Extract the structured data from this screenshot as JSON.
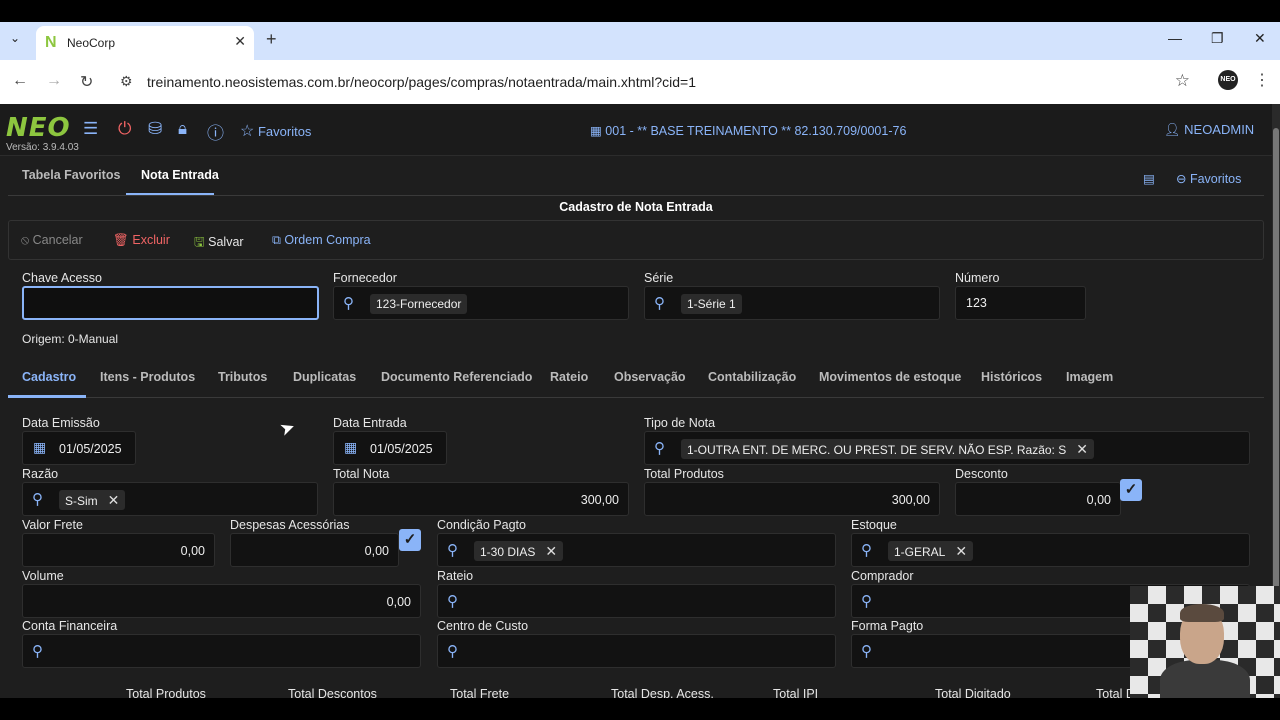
{
  "browser": {
    "tab_title": "NeoCorp",
    "tab_close": "✕",
    "new_tab": "+",
    "url": "treinamento.neosistemas.com.br/neocorp/pages/compras/notaentrada/main.xhtml?cid=1",
    "avatar_text": "NEO"
  },
  "app": {
    "logo": "NEO",
    "version": "Versão: 3.9.4.03",
    "favorites_label": "Favoritos",
    "company": "001 - ** BASE TREINAMENTO ** 82.130.709/0001-76",
    "user": "NEOADMIN"
  },
  "page_tabs": [
    "Tabela Favoritos",
    "Nota Entrada"
  ],
  "page_favorites": "Favoritos",
  "form": {
    "title": "Cadastro de Nota Entrada",
    "actions": {
      "cancel": "Cancelar",
      "delete": "Excluir",
      "save": "Salvar",
      "purchase_order": "Ordem Compra"
    },
    "chave_acesso": {
      "label": "Chave Acesso",
      "value": ""
    },
    "fornecedor": {
      "label": "Fornecedor",
      "value": "123-Fornecedor"
    },
    "serie": {
      "label": "Série",
      "value": "1-Série 1"
    },
    "numero": {
      "label": "Número",
      "value": "123"
    },
    "origem": "Origem: 0-Manual"
  },
  "sub_tabs": [
    "Cadastro",
    "Itens - Produtos",
    "Tributos",
    "Duplicatas",
    "Documento Referenciado",
    "Rateio",
    "Observação",
    "Contabilização",
    "Movimentos de estoque",
    "Históricos",
    "Imagem"
  ],
  "cadastro": {
    "data_emissao": {
      "label": "Data Emissão",
      "value": "01/05/2025"
    },
    "data_entrada": {
      "label": "Data Entrada",
      "value": "01/05/2025"
    },
    "tipo_nota": {
      "label": "Tipo de Nota",
      "value": "1-OUTRA ENT. DE MERC. OU PREST. DE SERV. NÃO ESP. Razão: S"
    },
    "razao": {
      "label": "Razão",
      "value": "S-Sim"
    },
    "total_nota": {
      "label": "Total Nota",
      "value": "300,00"
    },
    "total_produtos": {
      "label": "Total Produtos",
      "value": "300,00"
    },
    "desconto": {
      "label": "Desconto",
      "value": "0,00"
    },
    "valor_frete": {
      "label": "Valor Frete",
      "value": "0,00"
    },
    "despesas": {
      "label": "Despesas Acessórias",
      "value": "0,00"
    },
    "condicao": {
      "label": "Condição Pagto",
      "value": "1-30 DIAS"
    },
    "estoque": {
      "label": "Estoque",
      "value": "1-GERAL"
    },
    "volume": {
      "label": "Volume",
      "value": "0,00"
    },
    "rateio": {
      "label": "Rateio"
    },
    "comprador": {
      "label": "Comprador"
    },
    "conta_financeira": {
      "label": "Conta Financeira"
    },
    "centro_custo": {
      "label": "Centro de Custo"
    },
    "forma_pagto": {
      "label": "Forma Pagto"
    }
  },
  "totals": [
    "Total Produtos",
    "Total Descontos",
    "Total Frete",
    "Total Desp. Acess.",
    "Total IPI",
    "Total Digitado",
    "Total D"
  ],
  "colors": {
    "accent": "#8ab4f8",
    "brand": "#8dc63f",
    "danger": "#f06464",
    "success": "#8dc63f"
  }
}
